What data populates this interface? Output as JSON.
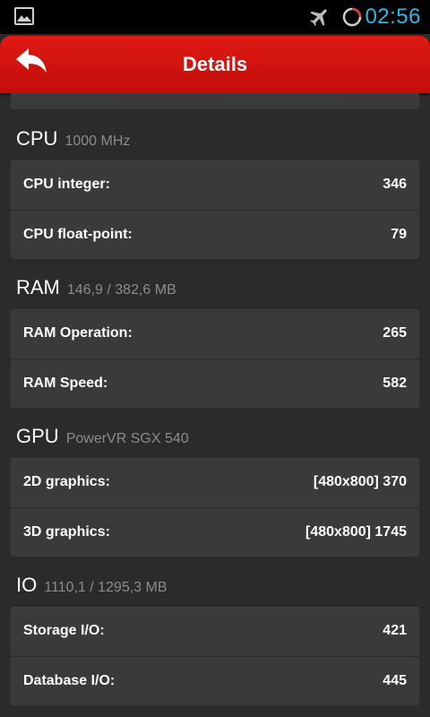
{
  "status_bar": {
    "time": "02:56",
    "icons": [
      "gallery-icon",
      "airplane-mode-icon",
      "sync-icon"
    ]
  },
  "header": {
    "title": "Details",
    "back_icon": "back-arrow-icon"
  },
  "colors": {
    "header_red": "#d3130f",
    "background": "#2b2b2b",
    "card": "#3a3a3a",
    "time_blue": "#33b5e5",
    "subtitle_gray": "#8c8c8c"
  },
  "sections": [
    {
      "title": "CPU",
      "subtitle": "1000 MHz",
      "rows": [
        {
          "label": "CPU integer:",
          "value": "346"
        },
        {
          "label": "CPU float-point:",
          "value": "79"
        }
      ]
    },
    {
      "title": "RAM",
      "subtitle": "146,9 / 382,6 MB",
      "rows": [
        {
          "label": "RAM Operation:",
          "value": "265"
        },
        {
          "label": "RAM Speed:",
          "value": "582"
        }
      ]
    },
    {
      "title": "GPU",
      "subtitle": "PowerVR SGX 540",
      "rows": [
        {
          "label": "2D graphics:",
          "value": "[480x800] 370"
        },
        {
          "label": "3D graphics:",
          "value": "[480x800] 1745"
        }
      ]
    },
    {
      "title": "IO",
      "subtitle": "1110,1 / 1295,3 MB",
      "rows": [
        {
          "label": "Storage I/O:",
          "value": "421"
        },
        {
          "label": "Database I/O:",
          "value": "445"
        }
      ]
    }
  ]
}
